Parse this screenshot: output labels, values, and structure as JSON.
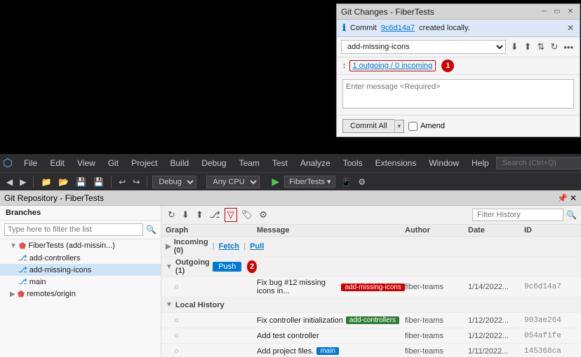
{
  "panel": {
    "title": "Git Changes - FiberTests",
    "info_text": "Commit ",
    "info_link": "9c6d14a7",
    "info_suffix": " created locally.",
    "branch_value": "add-missing-icons",
    "sync_label": "1 outgoing / 0 incoming",
    "message_placeholder": "Enter message <Required>",
    "commit_label": "Commit All",
    "amend_label": "Amend",
    "badge_number": "1"
  },
  "menu": {
    "items": [
      "File",
      "Edit",
      "View",
      "Git",
      "Project",
      "Build",
      "Debug",
      "Team",
      "Test",
      "Analyze",
      "Tools",
      "Extensions",
      "Window",
      "Help"
    ],
    "search_placeholder": "Search (Ctrl+Q)"
  },
  "toolbar": {
    "config": "Debug",
    "platform": "Any CPU",
    "project": "FiberTests"
  },
  "git_repo": {
    "title": "Git Repository - FiberTests",
    "filter_placeholder": "Type here to filter the list",
    "filter_history_placeholder": "Filter History",
    "branches_label": "Branches",
    "tree_items": [
      {
        "label": "FiberTests (add-missin...)",
        "indent": 1,
        "type": "branch-root",
        "icon": "expand"
      },
      {
        "label": "add-controllers",
        "indent": 2,
        "type": "branch",
        "selected": false
      },
      {
        "label": "add-missing-icons",
        "indent": 2,
        "type": "branch",
        "selected": true
      },
      {
        "label": "main",
        "indent": 2,
        "type": "branch",
        "selected": false
      },
      {
        "label": "remotes/origin",
        "indent": 1,
        "type": "remote",
        "icon": "expand"
      }
    ],
    "columns": [
      "Graph",
      "Message",
      "Author",
      "Date",
      "ID"
    ],
    "rows": [
      {
        "type": "section",
        "graph": "Incoming (0)",
        "fetch": "Fetch",
        "pull": "Pull",
        "message": "",
        "author": "",
        "date": "",
        "id": ""
      },
      {
        "type": "section",
        "graph": "Outgoing (1)",
        "push": "Push",
        "message": "",
        "author": "",
        "date": "",
        "id": ""
      },
      {
        "type": "commit",
        "graph_label": "",
        "message": "Fix bug #12 missing icons in...",
        "tag": "add-missing-icons",
        "tag_color": "red",
        "author": "fiber-teams",
        "date": "1/14/2022...",
        "id": "9c6d14a7"
      },
      {
        "type": "section",
        "graph": "Local History",
        "message": "",
        "author": "",
        "date": "",
        "id": ""
      },
      {
        "type": "commit",
        "message": "Fix controller initialization",
        "tag": "add-controllers",
        "tag_color": "green",
        "author": "fiber-teams",
        "date": "1/12/2022...",
        "id": "903ae264"
      },
      {
        "type": "commit",
        "message": "Add test controller",
        "tag": "",
        "tag_color": "",
        "author": "fiber-teams",
        "date": "1/12/2022...",
        "id": "054af1fe"
      },
      {
        "type": "commit",
        "message": "Add project files.",
        "tag": "main",
        "tag_color": "blue",
        "author": "fiber-teams",
        "date": "1/11/2022...",
        "id": "145368ca"
      }
    ]
  },
  "circles": {
    "c1_label": "1",
    "c2_label": "2"
  }
}
